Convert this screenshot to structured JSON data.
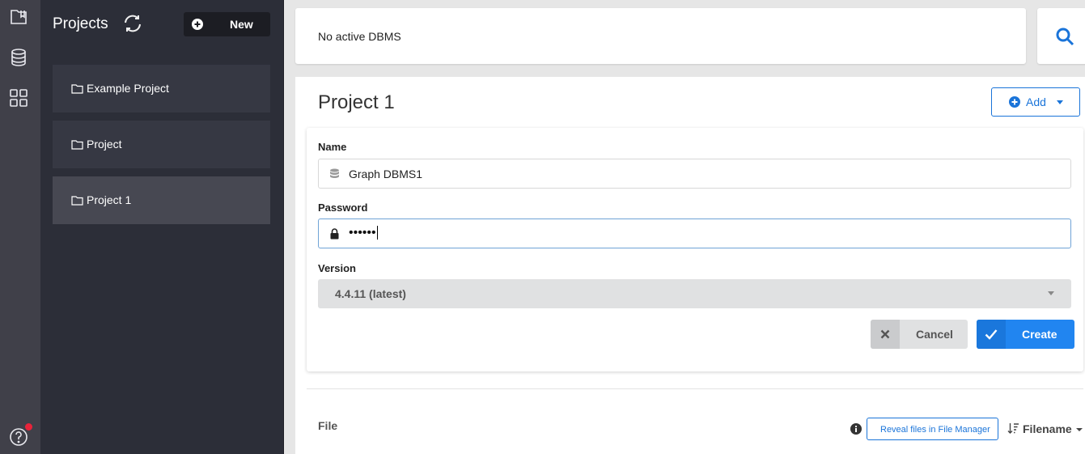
{
  "rail": {
    "icons": [
      "projects-icon",
      "database-icon",
      "apps-grid-icon",
      "help-icon"
    ],
    "notification_color": "#e8233a"
  },
  "projects_panel": {
    "title": "Projects",
    "new_button_label": "New",
    "items": [
      {
        "label": "Example Project",
        "active": false
      },
      {
        "label": "Project",
        "active": false
      },
      {
        "label": "Project 1",
        "active": true
      }
    ]
  },
  "topbar": {
    "status": "No active DBMS"
  },
  "main": {
    "title": "Project 1",
    "add_button_label": "Add",
    "form": {
      "name_label": "Name",
      "name_value": "Graph DBMS1",
      "password_label": "Password",
      "password_value": "••••••",
      "version_label": "Version",
      "version_value": "4.4.11 (latest)",
      "cancel_label": "Cancel",
      "create_label": "Create"
    },
    "files": {
      "label": "File",
      "reveal_button_label": "Reveal files in File Manager",
      "sort_label": "Filename"
    }
  },
  "colors": {
    "accent": "#2185f0",
    "link": "#1a74d9",
    "rail_bg": "#404049",
    "panel_bg": "#2c2e38"
  }
}
